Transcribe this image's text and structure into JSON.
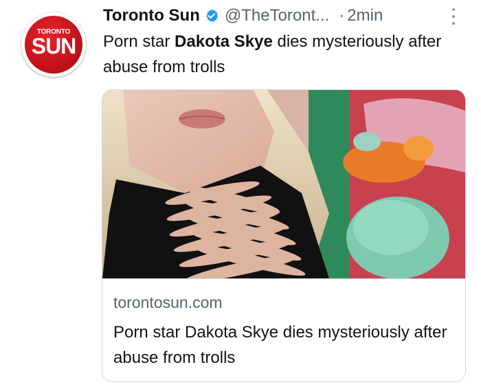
{
  "account": {
    "logo_top": "TORONTO",
    "logo_bottom": "SUN",
    "name": "Toronto Sun",
    "handle": "@TheToront...",
    "separator": "·",
    "time": "2min",
    "verified_color": "#1d9bf0",
    "avatar_color": "#c4121b"
  },
  "tweet": {
    "text_before": "Porn star ",
    "text_bold": "Dakota Skye",
    "text_after": " dies mysteriously after abuse from trolls"
  },
  "card": {
    "domain": "torontosun.com",
    "title": "Porn star Dakota Skye dies mysteriously after abuse from trolls"
  },
  "icons": {
    "verified": "verified-badge-icon",
    "more": "more-options-icon"
  }
}
